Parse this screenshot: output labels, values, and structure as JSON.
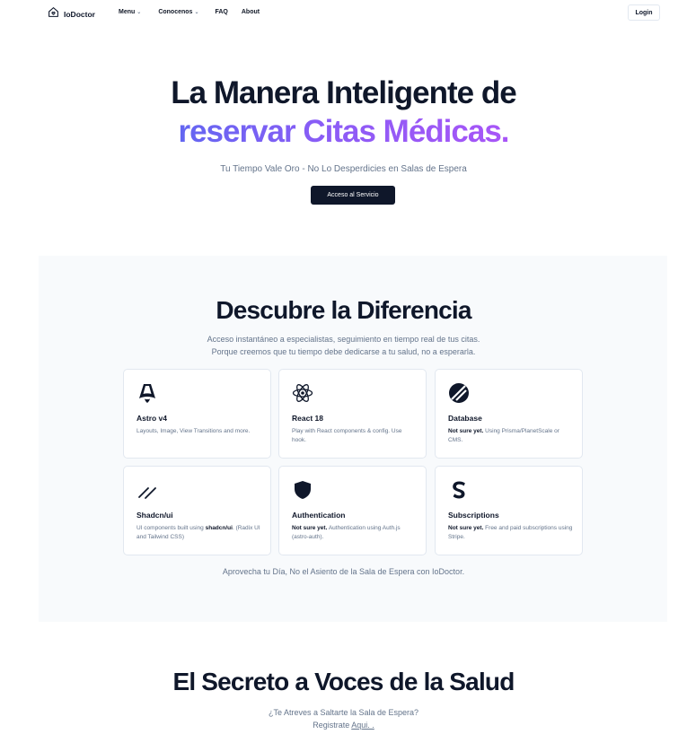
{
  "header": {
    "brand": "IoDoctor",
    "nav": [
      {
        "label": "Menu",
        "has_dropdown": true
      },
      {
        "label": "Conocenos",
        "has_dropdown": true
      },
      {
        "label": "FAQ",
        "has_dropdown": false
      },
      {
        "label": "About",
        "has_dropdown": false
      }
    ],
    "login_label": "Login"
  },
  "hero": {
    "title_line1": "La Manera Inteligente de",
    "title_line2": "reservar Citas Médicas.",
    "subtitle": "Tu Tiempo Vale Oro - No Lo Desperdicies en Salas de Espera",
    "cta_label": "Acceso al Servicio"
  },
  "features": {
    "title": "Descubre la Diferencia",
    "subtitle_line1": "Acceso instantáneo a especialistas, seguimiento en tiempo real de tus citas.",
    "subtitle_line2": "Porque creemos que tu tiempo debe dedicarse a tu salud, no a esperarla.",
    "cards": [
      {
        "icon": "astro-icon",
        "title": "Astro v4",
        "desc": "Layouts, Image, View Transitions and more."
      },
      {
        "icon": "react-icon",
        "title": "React 18",
        "desc": "Play with React components & config. Use hook."
      },
      {
        "icon": "database-icon",
        "title": "Database",
        "desc_bold": "Not sure yet.",
        "desc": " Using Prisma/PlanetScale or CMS."
      },
      {
        "icon": "shadcn-icon",
        "title": "Shadcn/ui",
        "desc_pre": "UI components built using ",
        "desc_bold": "shadcn/ui",
        "desc": ". (Radix UI and Tailwind CSS)"
      },
      {
        "icon": "shield-icon",
        "title": "Authentication",
        "desc_bold": "Not sure yet.",
        "desc": " Authentication using Auth.js (astro-auth)."
      },
      {
        "icon": "stripe-icon",
        "title": "Subscriptions",
        "desc_bold": "Not sure yet.",
        "desc": " Free and paid subscriptions using Stripe."
      }
    ],
    "footer": "Aprovecha tu Día, No el Asiento de la Sala de Espera con IoDoctor."
  },
  "secret": {
    "title": "El Secreto a Voces de la Salud",
    "question": "¿Te Atreves a Saltarte la Sala de Espera?",
    "register_prefix": "Registrate ",
    "register_link": "Aqui. ."
  }
}
